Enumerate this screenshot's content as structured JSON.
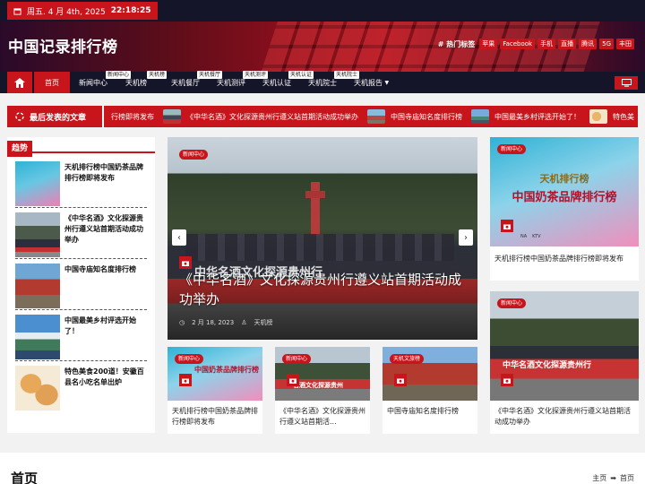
{
  "topbar": {
    "date": "周五. 4 月 4th, 2025",
    "time": "22:18:25"
  },
  "site": {
    "title": "中国记录排行榜"
  },
  "hot_tags": {
    "label": "热门标签",
    "items": [
      "苹果",
      "Facebook",
      "手机",
      "直播",
      "腾讯",
      "5G",
      "丰田"
    ]
  },
  "nav": {
    "items": [
      {
        "label": "首页",
        "badge": ""
      },
      {
        "label": "新闻中心",
        "badge": ""
      },
      {
        "label": "天机榜",
        "badge": "新闻中心"
      },
      {
        "label": "天机餐厅",
        "badge": "天机榜"
      },
      {
        "label": "天机测评",
        "badge": "天机餐厅"
      },
      {
        "label": "天机认证",
        "badge": "天机测评"
      },
      {
        "label": "天机院士",
        "badge": "天机认证"
      },
      {
        "label": "天机报告",
        "badge": "天机院士"
      }
    ]
  },
  "ticker": {
    "heading": "最后发表的文章",
    "items": [
      "行榜即将发布",
      "《中华名酒》文化探源贵州行遵义站首期活动成功举办",
      "中国寺庙知名度排行榜",
      "中国最美乡村评选开始了！",
      "特色美"
    ]
  },
  "trending": {
    "heading": "趋势",
    "items": [
      "天机排行榜中国奶茶品牌排行榜即将发布",
      "《中华名酒》文化探源贵州行遵义站首期活动成功举办",
      "中国寺庙知名度排行榜",
      "中国最美乡村评选开始了！",
      "特色美食200道！安徽百县名小吃名单出炉"
    ]
  },
  "feature": {
    "category": "新闻中心",
    "title": "《中华名酒》文化探源贵州行遵义站首期活动成功举办",
    "date": "2 月 18, 2023",
    "author": "天机榜",
    "banner_text": "中华名酒文化探源贵州行"
  },
  "cards": [
    {
      "category": "新闻中心",
      "title": "天机排行榜中国奶茶品牌排行榜即将发布",
      "img_text": "中国奶茶品牌排行榜"
    },
    {
      "category": "新闻中心",
      "title": "《中华名酒》文化探源贵州行遵义站首期活...",
      "img_text": "名酒文化探源贵州"
    },
    {
      "category": "天机文旅榜",
      "title": "中国寺庙知名度排行榜",
      "img_text": ""
    },
    {
      "category": "新闻中心",
      "title": "《中华名酒》文化探源贵州行遵义站首期活动成功举办",
      "img_text": ""
    }
  ],
  "right_cards": [
    {
      "category": "新闻中心",
      "title": "天机排行榜中国奶茶品牌排行榜即将发布",
      "img_brand": "天机排行榜",
      "img_text": "中国奶茶品牌排行榜",
      "logos": [
        "NA",
        "KTV"
      ]
    },
    {
      "category": "新闻中心",
      "title": "《中华名酒》文化探源贵州行遵义站首期活动成功举办",
      "img_text": "中华名酒文化探源贵州行"
    }
  ],
  "page": {
    "title": "首页",
    "breadcrumb": [
      "主页",
      "首页"
    ]
  },
  "colors": {
    "accent": "#c8151c",
    "dark": "#15152a"
  }
}
